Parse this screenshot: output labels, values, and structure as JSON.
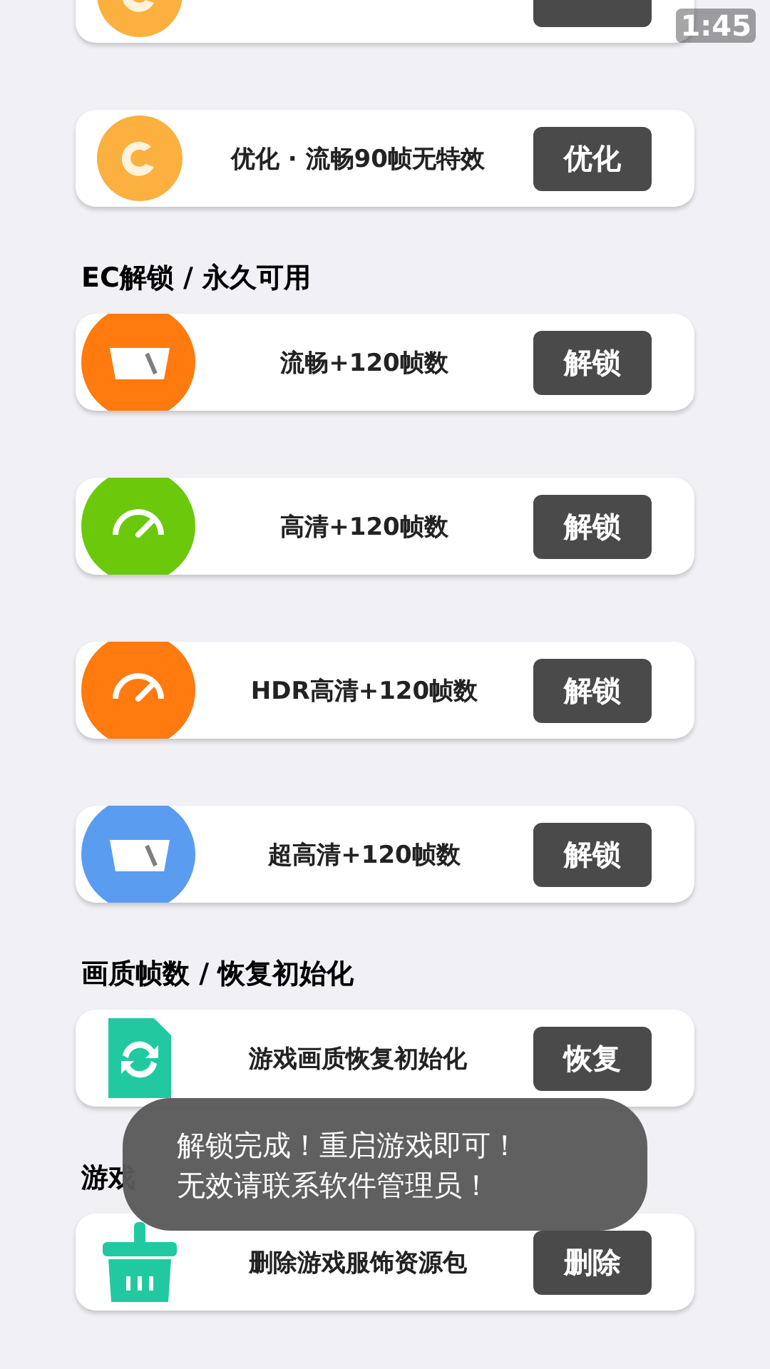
{
  "sections": [
    {
      "items": [
        {
          "kind": "swirl",
          "color": "#fbb040"
        }
      ]
    },
    {
      "items": [
        {
          "kind": "swirl",
          "color": "#fbb040",
          "label": "优化 · 流畅90帧无特效",
          "button": "优化"
        }
      ]
    },
    {
      "title": "EC解锁 / 永久可用",
      "items": [
        {
          "kind": "screen",
          "color": "#ff7a0f",
          "label": "流畅+120帧数",
          "button": "解锁"
        },
        {
          "kind": "gauge",
          "color": "#6cc80a",
          "label": "高清+120帧数",
          "button": "解锁"
        },
        {
          "kind": "gauge",
          "color": "#ff7a0f",
          "label": "HDR高清+120帧数",
          "button": "解锁"
        },
        {
          "kind": "screen",
          "color": "#5a9cf0",
          "label": "超高清+120帧数",
          "button": "解锁"
        }
      ]
    },
    {
      "title": "画质帧数 / 恢复初始化",
      "items": [
        {
          "kind": "refresh",
          "color": "#22c9a0",
          "label": "游戏画质恢复初始化",
          "button": "恢复"
        }
      ]
    },
    {
      "title": "游戏",
      "items": [
        {
          "kind": "basket",
          "color": "#22c9a0",
          "label": "删除游戏服饰资源包",
          "button": "删除"
        }
      ]
    }
  ],
  "toast": [
    "解锁完成！重启游戏即可！",
    "无效请联系软件管理员！"
  ],
  "overlay_time": "1:45"
}
